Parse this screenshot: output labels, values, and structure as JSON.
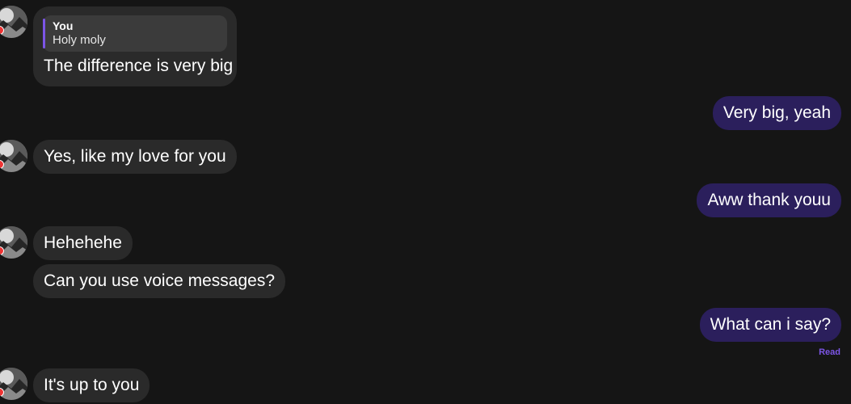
{
  "messages": [
    {
      "id": "m1",
      "direction": "in",
      "reply_to": {
        "author": "You",
        "text": "Holy moly"
      },
      "text": "The difference is very big"
    },
    {
      "id": "m2",
      "direction": "out",
      "text": "Very big, yeah"
    },
    {
      "id": "m3",
      "direction": "in",
      "text": "Yes, like my love for you"
    },
    {
      "id": "m4",
      "direction": "out",
      "text": "Aww thank youu"
    },
    {
      "id": "m5",
      "direction": "in",
      "text": "Hehehehe"
    },
    {
      "id": "m6",
      "direction": "in",
      "text": "Can you use voice messages?"
    },
    {
      "id": "m7",
      "direction": "out",
      "text": "What can i say?"
    },
    {
      "id": "m8",
      "direction": "in",
      "text": "It's up to you"
    }
  ],
  "read_receipt": "Read",
  "colors": {
    "background": "#151515",
    "incoming_bubble": "#2a2a2a",
    "outgoing_bubble": "#2b1f5c",
    "accent": "#7c55e6"
  },
  "icons": {
    "avatar": "contact-avatar",
    "avatar_badge": "status-badge"
  }
}
